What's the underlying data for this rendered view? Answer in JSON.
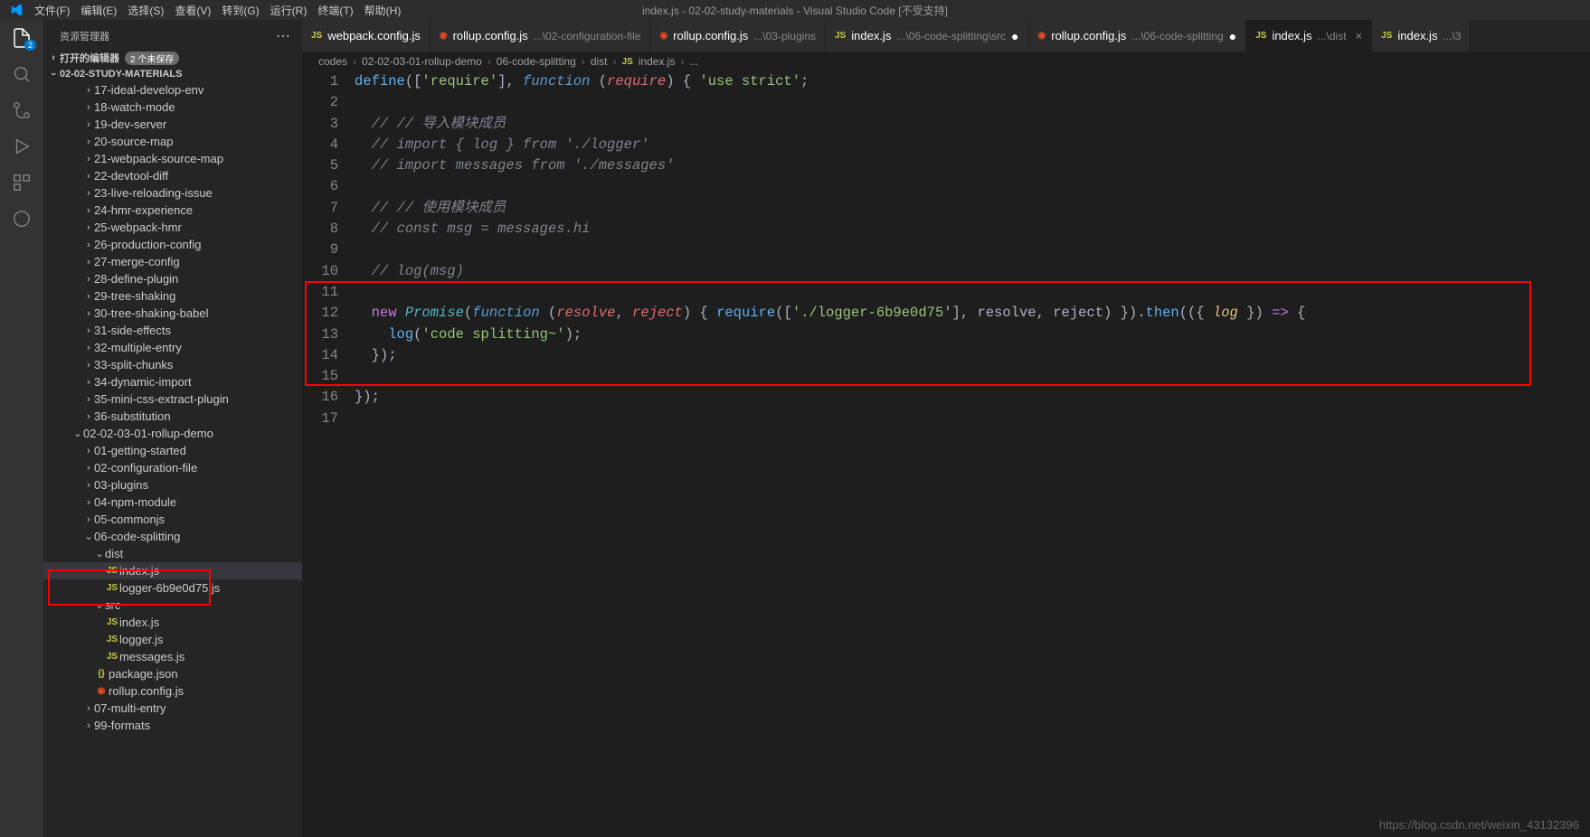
{
  "menubar": {
    "items": [
      "文件(F)",
      "编辑(E)",
      "选择(S)",
      "查看(V)",
      "转到(G)",
      "运行(R)",
      "终端(T)",
      "帮助(H)"
    ],
    "title": "index.js - 02-02-study-materials - Visual Studio Code [不受支持]"
  },
  "activitybar": {
    "explorer_badge": "2"
  },
  "sidebar": {
    "title": "资源管理器",
    "open_editors_label": "打开的编辑器",
    "open_editors_badge": "2 个未保存",
    "root_label": "02-02-STUDY-MATERIALS",
    "tree": [
      {
        "indent": 3,
        "type": "folder",
        "label": "17-ideal-develop-env",
        "open": false
      },
      {
        "indent": 3,
        "type": "folder",
        "label": "18-watch-mode",
        "open": false
      },
      {
        "indent": 3,
        "type": "folder",
        "label": "19-dev-server",
        "open": false
      },
      {
        "indent": 3,
        "type": "folder",
        "label": "20-source-map",
        "open": false
      },
      {
        "indent": 3,
        "type": "folder",
        "label": "21-webpack-source-map",
        "open": false
      },
      {
        "indent": 3,
        "type": "folder",
        "label": "22-devtool-diff",
        "open": false
      },
      {
        "indent": 3,
        "type": "folder",
        "label": "23-live-reloading-issue",
        "open": false
      },
      {
        "indent": 3,
        "type": "folder",
        "label": "24-hmr-experience",
        "open": false
      },
      {
        "indent": 3,
        "type": "folder",
        "label": "25-webpack-hmr",
        "open": false
      },
      {
        "indent": 3,
        "type": "folder",
        "label": "26-production-config",
        "open": false
      },
      {
        "indent": 3,
        "type": "folder",
        "label": "27-merge-config",
        "open": false
      },
      {
        "indent": 3,
        "type": "folder",
        "label": "28-define-plugin",
        "open": false
      },
      {
        "indent": 3,
        "type": "folder",
        "label": "29-tree-shaking",
        "open": false
      },
      {
        "indent": 3,
        "type": "folder",
        "label": "30-tree-shaking-babel",
        "open": false
      },
      {
        "indent": 3,
        "type": "folder",
        "label": "31-side-effects",
        "open": false
      },
      {
        "indent": 3,
        "type": "folder",
        "label": "32-multiple-entry",
        "open": false
      },
      {
        "indent": 3,
        "type": "folder",
        "label": "33-split-chunks",
        "open": false
      },
      {
        "indent": 3,
        "type": "folder",
        "label": "34-dynamic-import",
        "open": false
      },
      {
        "indent": 3,
        "type": "folder",
        "label": "35-mini-css-extract-plugin",
        "open": false
      },
      {
        "indent": 3,
        "type": "folder",
        "label": "36-substitution",
        "open": false
      },
      {
        "indent": 2,
        "type": "folder",
        "label": "02-02-03-01-rollup-demo",
        "open": true
      },
      {
        "indent": 3,
        "type": "folder",
        "label": "01-getting-started",
        "open": false
      },
      {
        "indent": 3,
        "type": "folder",
        "label": "02-configuration-file",
        "open": false
      },
      {
        "indent": 3,
        "type": "folder",
        "label": "03-plugins",
        "open": false
      },
      {
        "indent": 3,
        "type": "folder",
        "label": "04-npm-module",
        "open": false
      },
      {
        "indent": 3,
        "type": "folder",
        "label": "05-commonjs",
        "open": false
      },
      {
        "indent": 3,
        "type": "folder",
        "label": "06-code-splitting",
        "open": true
      },
      {
        "indent": 4,
        "type": "folder",
        "label": "dist",
        "open": true
      },
      {
        "indent": 5,
        "type": "file-js",
        "label": "index.js",
        "selected": true
      },
      {
        "indent": 5,
        "type": "file-js",
        "label": "logger-6b9e0d75.js"
      },
      {
        "indent": 4,
        "type": "folder",
        "label": "src",
        "open": true
      },
      {
        "indent": 5,
        "type": "file-js",
        "label": "index.js"
      },
      {
        "indent": 5,
        "type": "file-js",
        "label": "logger.js"
      },
      {
        "indent": 5,
        "type": "file-js",
        "label": "messages.js"
      },
      {
        "indent": 4,
        "type": "file-json",
        "label": "package.json"
      },
      {
        "indent": 4,
        "type": "file-rollup",
        "label": "rollup.config.js"
      },
      {
        "indent": 3,
        "type": "folder",
        "label": "07-multi-entry",
        "open": false
      },
      {
        "indent": 3,
        "type": "folder",
        "label": "99-formats",
        "open": false
      }
    ]
  },
  "tabs": [
    {
      "ico": "js",
      "label": "webpack.config.js",
      "path": "",
      "dirty": false,
      "active": false
    },
    {
      "ico": "rollup",
      "label": "rollup.config.js",
      "path": "...\\02-configuration-file",
      "dirty": false,
      "active": false
    },
    {
      "ico": "rollup",
      "label": "rollup.config.js",
      "path": "...\\03-plugins",
      "dirty": false,
      "active": false
    },
    {
      "ico": "js",
      "label": "index.js",
      "path": "...\\06-code-splitting\\src",
      "dirty": true,
      "active": false
    },
    {
      "ico": "rollup",
      "label": "rollup.config.js",
      "path": "...\\06-code-splitting",
      "dirty": true,
      "active": false
    },
    {
      "ico": "js",
      "label": "index.js",
      "path": "...\\dist",
      "dirty": false,
      "active": true,
      "close": true
    },
    {
      "ico": "js",
      "label": "index.js",
      "path": "...\\3",
      "dirty": false,
      "active": false
    }
  ],
  "breadcrumbs": [
    "codes",
    "02-02-03-01-rollup-demo",
    "06-code-splitting",
    "dist",
    "index.js",
    "..."
  ],
  "breadcrumb_file_ico": "JS",
  "code": {
    "lines": [
      {
        "n": 1,
        "html": "<span class='tok-func'>define</span><span class='tok-punct'>([</span><span class='tok-string'>'require'</span><span class='tok-punct'>], </span><span class='tok-keyword2'>function</span><span class='tok-punct'> (</span><span class='tok-param'>require</span><span class='tok-punct'>) { </span><span class='tok-string'>'use strict'</span><span class='tok-punct'>;</span>"
      },
      {
        "n": 2,
        "html": ""
      },
      {
        "n": 3,
        "html": "  <span class='tok-comment'>// // 导入模块成员</span>"
      },
      {
        "n": 4,
        "html": "  <span class='tok-comment'>// import { log } from './logger'</span>"
      },
      {
        "n": 5,
        "html": "  <span class='tok-comment'>// import messages from './messages'</span>"
      },
      {
        "n": 6,
        "html": ""
      },
      {
        "n": 7,
        "html": "  <span class='tok-comment'>// // 使用模块成员</span>"
      },
      {
        "n": 8,
        "html": "  <span class='tok-comment'>// const msg = messages.hi</span>"
      },
      {
        "n": 9,
        "html": ""
      },
      {
        "n": 10,
        "html": "  <span class='tok-comment'>// log(msg)</span>"
      },
      {
        "n": 11,
        "html": ""
      },
      {
        "n": 12,
        "html": "  <span class='tok-keyword'>new</span> <span class='tok-funcname'>Promise</span><span class='tok-punct'>(</span><span class='tok-keyword2'>function</span> <span class='tok-punct'>(</span><span class='tok-param'>resolve</span><span class='tok-punct'>, </span><span class='tok-param'>reject</span><span class='tok-punct'>) { </span><span class='tok-func'>require</span><span class='tok-punct'>([</span><span class='tok-string'>'./logger-6b9e0d75'</span><span class='tok-punct'>], </span><span class='tok-plain'>resolve</span><span class='tok-punct'>, </span><span class='tok-plain'>reject</span><span class='tok-punct'>) }).</span><span class='tok-func'>then</span><span class='tok-punct'>(({ </span><span class='tok-var'>log</span><span class='tok-punct'> }) </span><span class='tok-keyword'>=&gt;</span><span class='tok-punct'> {</span>"
      },
      {
        "n": 13,
        "html": "    <span class='tok-func'>log</span><span class='tok-punct'>(</span><span class='tok-string'>'code splitting~'</span><span class='tok-punct'>);</span>"
      },
      {
        "n": 14,
        "html": "  <span class='tok-punct'>});</span>"
      },
      {
        "n": 15,
        "html": ""
      },
      {
        "n": 16,
        "html": "<span class='tok-punct'>});</span>"
      },
      {
        "n": 17,
        "html": ""
      }
    ]
  },
  "watermark": "https://blog.csdn.net/weixin_43132396",
  "icons": {
    "js": "JS",
    "rollup": "◉",
    "json": "{}"
  }
}
